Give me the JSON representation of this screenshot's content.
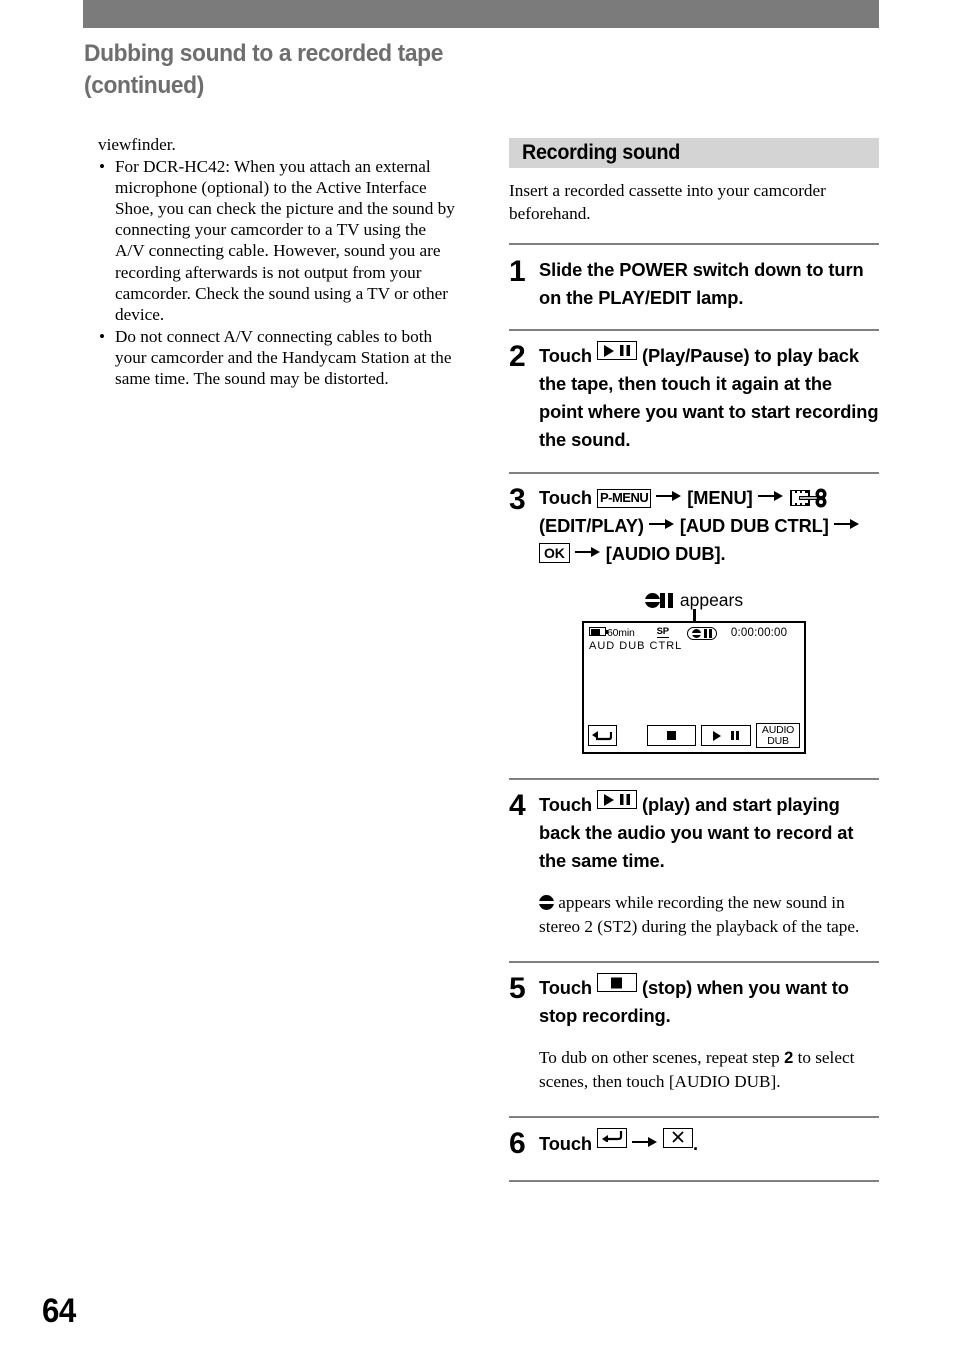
{
  "page": {
    "heading_line1": "Dubbing sound to a recorded tape",
    "heading_line2": "(continued)",
    "number": "64"
  },
  "left_column": {
    "continued_text": "viewfinder.",
    "bullets": [
      {
        "marker": "•",
        "text": "For DCR-HC42: When you attach an external microphone (optional) to the Active Interface Shoe, you can check the picture and the sound by connecting your camcorder to a TV using the A/V connecting cable. However, sound you are recording afterwards is not output from your camcorder. Check the sound using a TV or other device."
      },
      {
        "marker": "•",
        "text": "Do not connect A/V connecting cables to both your camcorder and the Handycam Station at the same time. The sound may be distorted."
      }
    ]
  },
  "right_column": {
    "section_title": "Recording sound",
    "intro": "Insert a recorded cassette into your camcorder beforehand.",
    "steps": [
      {
        "num": "1",
        "text": "Slide the POWER switch down to turn on the PLAY/EDIT lamp."
      },
      {
        "num": "2",
        "t1": "Touch",
        "icon1": "play-pause-icon",
        "t2": "(Play/Pause) to play back the tape, then touch it again at the point where you want to start recording the sound."
      },
      {
        "num": "3",
        "t1": "Touch",
        "pmenu_label": "P-MENU",
        "arrow": "→",
        "menu_label": "[MENU]",
        "editplay_icon": "edit-play-menu-icon",
        "editplay_label": "(EDIT/PLAY)",
        "aud_dub_ctrl_label": "[AUD DUB CTRL]",
        "ok_label": "OK",
        "audio_dub_label": "[AUDIO DUB]."
      },
      {
        "num": "4",
        "t1": "Touch",
        "icon1": "play-pause-icon",
        "t2": "(play) and start playing back the audio you want to record at the same time.",
        "note": "appears while recording the new sound in stereo 2 (ST2) during the playback of the tape."
      },
      {
        "num": "5",
        "t1": "Touch",
        "icon1": "stop-icon",
        "t2": "(stop) when you want to stop recording.",
        "note_a": "To dub on other scenes, repeat step",
        "note_b": "2",
        "note_c": "to select scenes, then touch [AUDIO DUB]."
      },
      {
        "num": "6",
        "t1": "Touch",
        "icon1": "return-icon",
        "arrow": "→",
        "icon2": "close-x-icon",
        "t2": "."
      }
    ],
    "appears_caption": "appears",
    "lcd": {
      "battery_time": "60min",
      "rec_mode": "SP",
      "timecode": "0:00:00:00",
      "mode_label": "AUD DUB CTRL",
      "buttons": [
        {
          "name": "return-button",
          "label": ""
        },
        {
          "name": "stop-button",
          "label": ""
        },
        {
          "name": "play-pause-button",
          "label": ""
        },
        {
          "name": "audio-dub-button",
          "label_line1": "AUDIO",
          "label_line2": "DUB"
        }
      ]
    }
  },
  "colors": {
    "top_bar": "#7b7b7b",
    "heading": "#6e6e6e",
    "band": "#d4d4d4",
    "rule": "#808080"
  }
}
